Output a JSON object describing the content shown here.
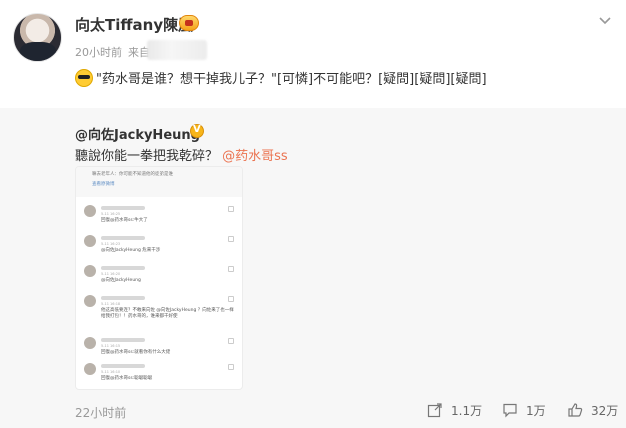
{
  "post": {
    "author": "向太Tiffany陳嵐",
    "time": "20小时前",
    "source_prefix": "来自",
    "text": "\"药水哥是谁？想干掉我儿子？\"[可憐]不可能吧？[疑問][疑問][疑問]",
    "emoji": "cool-sunglasses-emoji"
  },
  "repost": {
    "author": "@向佐JackyHeung",
    "text": "聽說你能一拳把我乾碎？",
    "mention": "@药水哥ss",
    "embedded_screenshot": {
      "title": "嘛去老年人：你可能不知道他的徒弟是谁",
      "link": "查看原微博",
      "comments": [
        {
          "time": "5-11 16:25",
          "body": "回復@药水哥ss:牛大了"
        },
        {
          "time": "5-11 16:23",
          "body": "@向佐JackyHeung 危来干涉"
        },
        {
          "time": "5-11 16:20",
          "body": "@向佐JackyHeung"
        },
        {
          "time": "5-11 16:18",
          "body": "他这高低要连？不敢来向佐 @向佐JackyHeung ？向佐来了也一样给我打包！！药水哥的，谁来都干好使"
        },
        {
          "time": "5-11 16:15",
          "body": "回復@药水哥ss:就看你有什么大佬"
        },
        {
          "time": "5-11 16:10",
          "body": "回復@药水哥ss:聪聪聪聪"
        }
      ]
    },
    "time": "22小时前",
    "reposts": "1.1万",
    "comments": "1万",
    "likes": "32万"
  },
  "colors": {
    "accent": "#eb7350",
    "repost_bg": "#f7f7f7",
    "text": "#333333",
    "muted": "#999999"
  }
}
